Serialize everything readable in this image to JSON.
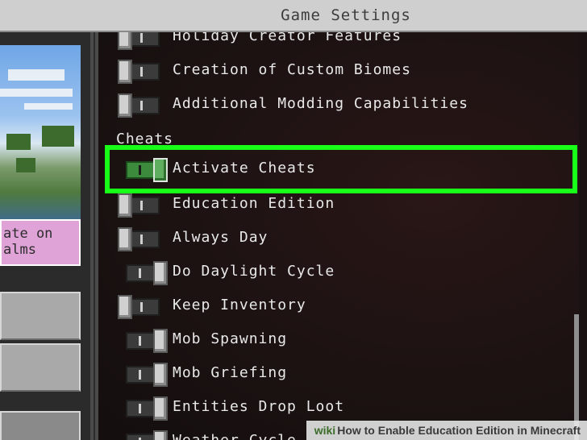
{
  "window": {
    "title": "Game Settings"
  },
  "left_panel": {
    "world_card_text": "ate on\nalms"
  },
  "settings": {
    "partial_top_label": "Holiday Creator Features",
    "items_top": [
      {
        "label": "Creation of Custom Biomes",
        "state": "off"
      },
      {
        "label": "Additional Modding Capabilities",
        "state": "off"
      }
    ],
    "cheats_section_title": "Cheats",
    "cheats_items": [
      {
        "label": "Activate Cheats",
        "state": "on",
        "highlighted": true
      },
      {
        "label": "Education Edition",
        "state": "off"
      },
      {
        "label": "Always Day",
        "state": "off"
      },
      {
        "label": "Do Daylight Cycle",
        "state": "on"
      },
      {
        "label": "Keep Inventory",
        "state": "off"
      },
      {
        "label": "Mob Spawning",
        "state": "on"
      },
      {
        "label": "Mob Griefing",
        "state": "on"
      },
      {
        "label": "Entities Drop Loot",
        "state": "on"
      }
    ],
    "partial_bottom_label": "Weather Cycle"
  },
  "colors": {
    "highlight": "#18ff18",
    "toggle_on_accent": "#3c8a3c"
  },
  "watermark": {
    "brand": "wiki",
    "text": "How to Enable Education Edition in Minecraft"
  }
}
